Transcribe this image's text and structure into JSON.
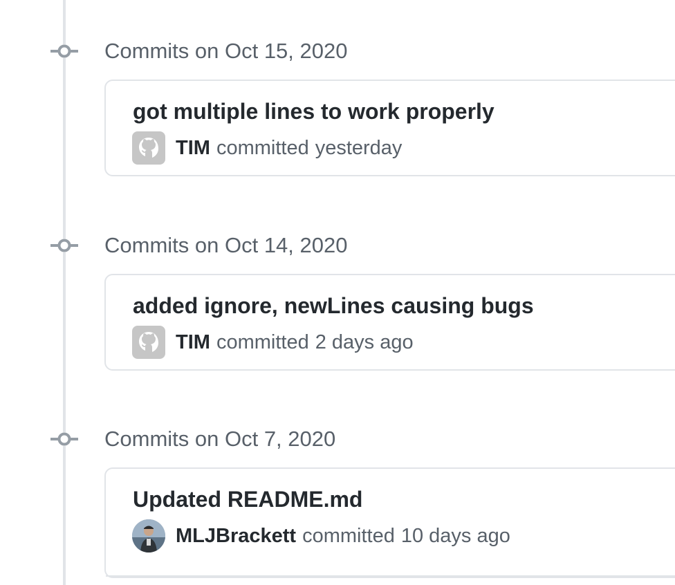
{
  "groups": [
    {
      "title": "Commits on Oct 15, 2020",
      "commits": [
        {
          "message": "got multiple lines to work properly",
          "author": "TIM",
          "verb": "committed",
          "time": "yesterday",
          "avatar_icon": "github-octocat-icon"
        }
      ]
    },
    {
      "title": "Commits on Oct 14, 2020",
      "commits": [
        {
          "message": "added ignore, newLines causing bugs",
          "author": "TIM",
          "verb": "committed",
          "time": "2 days ago",
          "avatar_icon": "github-octocat-icon"
        }
      ]
    },
    {
      "title": "Commits on Oct 7, 2020",
      "commits": [
        {
          "message": "Updated README.md",
          "author": "MLJBrackett",
          "verb": "committed",
          "time": "10 days ago",
          "avatar_icon": "user-photo"
        }
      ]
    }
  ],
  "colors": {
    "timeline": "#e1e4e8",
    "node": "#959da5",
    "title_text": "#586069",
    "message_text": "#24292e",
    "border": "#e1e4e8"
  }
}
